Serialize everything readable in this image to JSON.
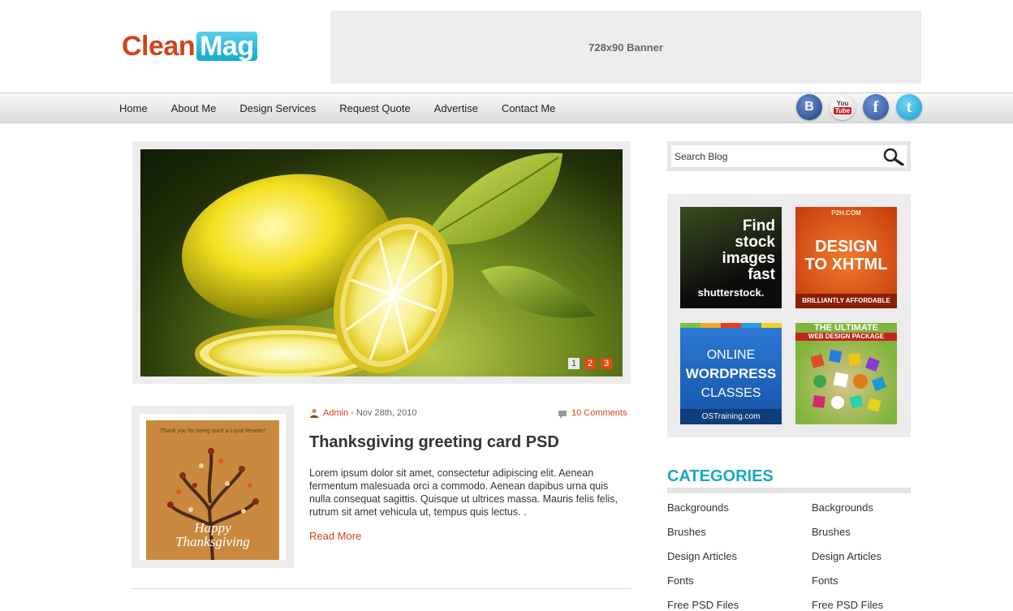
{
  "header": {
    "logo_part1": "Clean",
    "logo_part2": "Mag",
    "banner_label": "728x90 Banner"
  },
  "nav": {
    "items": [
      "Home",
      "About Me",
      "Design Services",
      "Request Quote",
      "Advertise",
      "Contact Me"
    ]
  },
  "social": {
    "blogger": "B",
    "youtube_you": "You",
    "youtube_tube": "Tube",
    "facebook": "f",
    "twitter": "t"
  },
  "slider": {
    "pages": [
      "1",
      "2",
      "3"
    ],
    "active_page": 1
  },
  "post": {
    "author": "Admin",
    "separator": "-",
    "date": "Nov 28th, 2010",
    "comments": "10 Comments",
    "title": "Thanksgiving greeting card PSD",
    "excerpt": "Lorem ipsum dolor sit amet, consectetur adipiscing elit. Aenean fermentum malesuada orci a commodo. Aenean dapibus urna quis nulla consequat sagittis. Quisque ut ultrices massa. Mauris felis felis, rutrum sit amet vehicula ut, tempus quis lectus. .",
    "read_more": "Read More",
    "card_top_text": "Thank you for being such a Loyal Reader!",
    "card_line1": "Happy",
    "card_line2": "Thanksgiving"
  },
  "sidebar": {
    "search_placeholder": "Search Blog",
    "ads": {
      "shutterstock_l1": "Find",
      "shutterstock_l2": "stock",
      "shutterstock_l3": "images",
      "shutterstock_l4": "fast",
      "shutterstock_brand": "shutterstock.",
      "p2h_top": "P2H.COM",
      "p2h_l1": "DESIGN",
      "p2h_l2": "TO XHTML",
      "p2h_bottom": "BRILLIANTLY AFFORDABLE",
      "os_l1": "ONLINE",
      "os_l2": "WORDPRESS",
      "os_l3": "CLASSES",
      "os_url": "OSTraining.com",
      "wd_l1": "THE ULTIMATE",
      "wd_l2": "WEB DESIGN PACKAGE"
    },
    "categories_title": "CATEGORIES",
    "categories": [
      [
        "Backgrounds",
        "Backgrounds"
      ],
      [
        "Brushes",
        "Brushes"
      ],
      [
        "Design Articles",
        "Design Articles"
      ],
      [
        "Fonts",
        "Fonts"
      ],
      [
        "Free PSD Files",
        "Free PSD Files"
      ]
    ]
  },
  "colors": {
    "accent_orange": "#d2421b",
    "accent_teal": "#17a8c6"
  }
}
